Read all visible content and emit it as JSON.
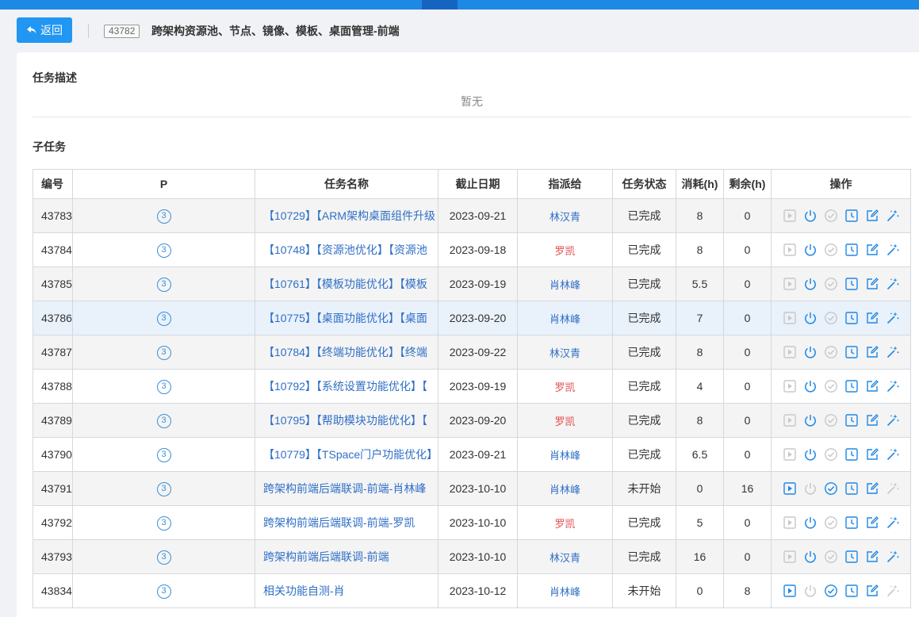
{
  "header": {
    "back_label": "返回",
    "task_id": "43782",
    "task_title": "跨架构资源池、节点、镜像、模板、桌面管理-前端"
  },
  "description": {
    "title": "任务描述",
    "empty_text": "暂无"
  },
  "subtasks": {
    "title": "子任务",
    "columns": [
      "编号",
      "P",
      "任务名称",
      "截止日期",
      "指派给",
      "任务状态",
      "消耗(h)",
      "剩余(h)",
      "操作"
    ],
    "rows": [
      {
        "id": "43783",
        "p": "3",
        "name": "【10729】【ARM架构桌面组件升级",
        "date": "2023-09-21",
        "assignee": "林汉青",
        "assignee_color": "#2f6fc6",
        "status": "已完成",
        "consumed": "8",
        "remaining": "0",
        "done": true
      },
      {
        "id": "43784",
        "p": "3",
        "name": "【10748】【资源池优化】【资源池",
        "date": "2023-09-18",
        "assignee": "罗凯",
        "assignee_color": "#e05252",
        "status": "已完成",
        "consumed": "8",
        "remaining": "0",
        "done": true
      },
      {
        "id": "43785",
        "p": "3",
        "name": "【10761】【模板功能优化】【模板",
        "date": "2023-09-19",
        "assignee": "肖林峰",
        "assignee_color": "#2f6fc6",
        "status": "已完成",
        "consumed": "5.5",
        "remaining": "0",
        "done": true
      },
      {
        "id": "43786",
        "p": "3",
        "name": "【10775】【桌面功能优化】【桌面",
        "date": "2023-09-20",
        "assignee": "肖林峰",
        "assignee_color": "#2f6fc6",
        "status": "已完成",
        "consumed": "7",
        "remaining": "0",
        "done": true
      },
      {
        "id": "43787",
        "p": "3",
        "name": "【10784】【终端功能优化】【终端",
        "date": "2023-09-22",
        "assignee": "林汉青",
        "assignee_color": "#2f6fc6",
        "status": "已完成",
        "consumed": "8",
        "remaining": "0",
        "done": true
      },
      {
        "id": "43788",
        "p": "3",
        "name": "【10792】【系统设置功能优化】【",
        "date": "2023-09-19",
        "assignee": "罗凯",
        "assignee_color": "#e05252",
        "status": "已完成",
        "consumed": "4",
        "remaining": "0",
        "done": true
      },
      {
        "id": "43789",
        "p": "3",
        "name": "【10795】【帮助模块功能优化】【",
        "date": "2023-09-20",
        "assignee": "罗凯",
        "assignee_color": "#e05252",
        "status": "已完成",
        "consumed": "8",
        "remaining": "0",
        "done": true
      },
      {
        "id": "43790",
        "p": "3",
        "name": "【10779】【TSpace门户功能优化】",
        "date": "2023-09-21",
        "assignee": "肖林峰",
        "assignee_color": "#2f6fc6",
        "status": "已完成",
        "consumed": "6.5",
        "remaining": "0",
        "done": true
      },
      {
        "id": "43791",
        "p": "3",
        "name": "跨架构前端后端联调-前端-肖林峰",
        "date": "2023-10-10",
        "assignee": "肖林峰",
        "assignee_color": "#2f6fc6",
        "status": "未开始",
        "consumed": "0",
        "remaining": "16",
        "done": false
      },
      {
        "id": "43792",
        "p": "3",
        "name": "跨架构前端后端联调-前端-罗凯",
        "date": "2023-10-10",
        "assignee": "罗凯",
        "assignee_color": "#e05252",
        "status": "已完成",
        "consumed": "5",
        "remaining": "0",
        "done": true
      },
      {
        "id": "43793",
        "p": "3",
        "name": "跨架构前端后端联调-前端",
        "date": "2023-10-10",
        "assignee": "林汉青",
        "assignee_color": "#2f6fc6",
        "status": "已完成",
        "consumed": "16",
        "remaining": "0",
        "done": true
      },
      {
        "id": "43834",
        "p": "3",
        "name": "相关功能自测-肖",
        "date": "2023-10-12",
        "assignee": "肖林峰",
        "assignee_color": "#2f6fc6",
        "status": "未开始",
        "consumed": "0",
        "remaining": "8",
        "done": false
      }
    ],
    "op_icons": [
      "start-icon",
      "power-icon",
      "check-circle-icon",
      "clock-icon",
      "edit-icon",
      "magic-wand-icon"
    ]
  },
  "colors": {
    "accent": "#2196f3",
    "link": "#2f6fc6",
    "active_icon": "#1e88e5",
    "disabled_icon": "#c8c8c8"
  }
}
